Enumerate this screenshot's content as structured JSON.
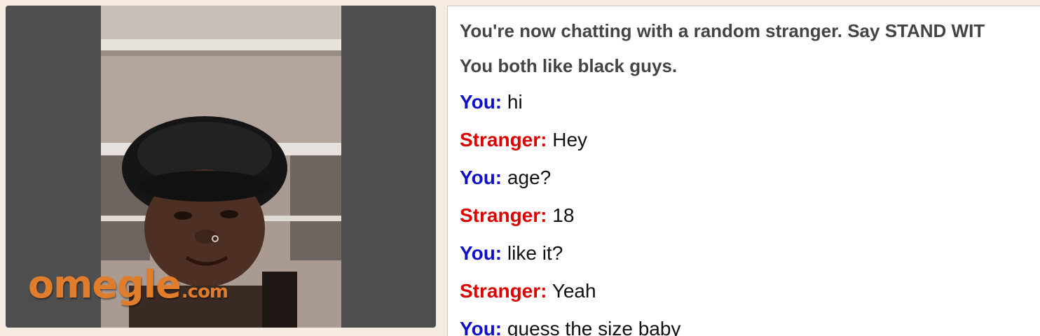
{
  "video": {
    "watermark_main": "omegle",
    "watermark_tld": ".com",
    "colors": {
      "frame": "#4e4e4e",
      "watermark": "#e07d2c"
    }
  },
  "chat": {
    "system_messages": [
      "You're now chatting with a random stranger. Say STAND WIT",
      "You both like black guys."
    ],
    "messages": [
      {
        "sender": "You:",
        "role": "you",
        "text": "hi"
      },
      {
        "sender": "Stranger:",
        "role": "stranger",
        "text": "Hey"
      },
      {
        "sender": "You:",
        "role": "you",
        "text": "age?"
      },
      {
        "sender": "Stranger:",
        "role": "stranger",
        "text": "18"
      },
      {
        "sender": "You:",
        "role": "you",
        "text": "like it?"
      },
      {
        "sender": "Stranger:",
        "role": "stranger",
        "text": "Yeah"
      },
      {
        "sender": "You:",
        "role": "you",
        "text": "guess the size baby"
      }
    ],
    "colors": {
      "you": "#1010cc",
      "stranger": "#dd0000",
      "system": "#444444"
    }
  }
}
